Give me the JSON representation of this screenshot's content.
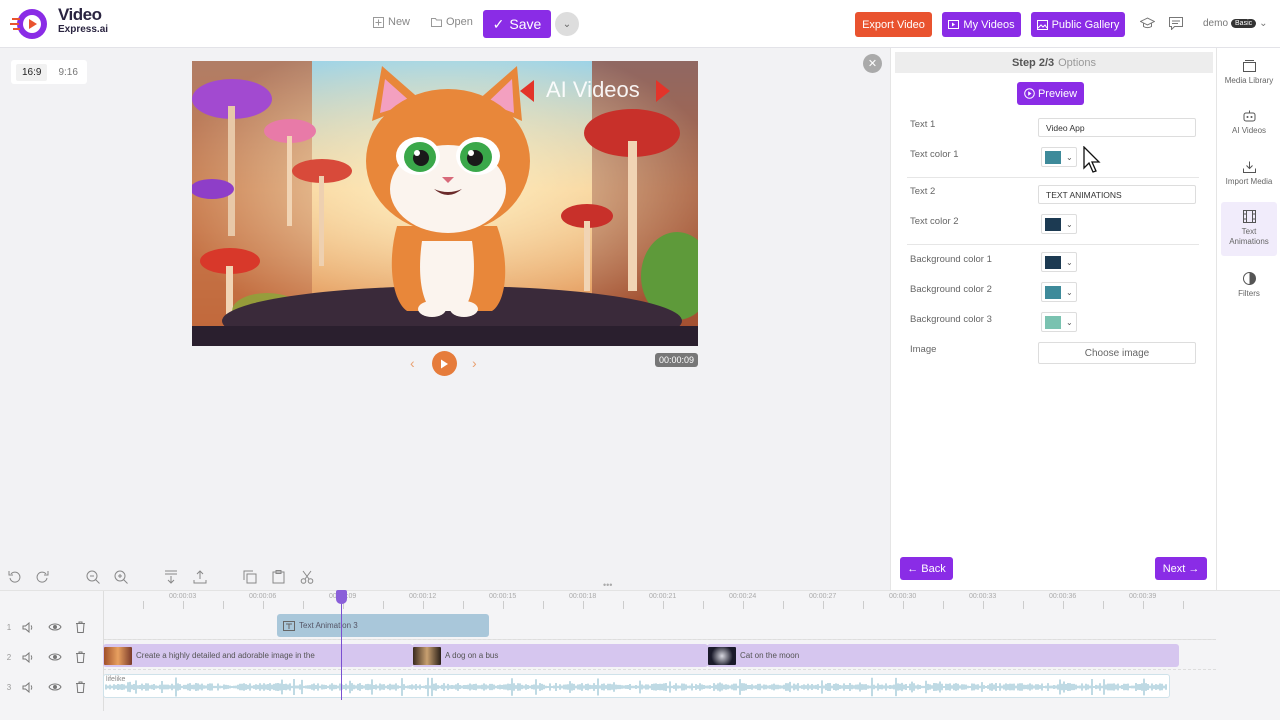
{
  "header": {
    "logo_line1": "Video",
    "logo_line2": "Express.ai",
    "new_label": "New",
    "open_label": "Open",
    "save_label": "Save",
    "export_label": "Export Video",
    "my_videos_label": "My Videos",
    "gallery_label": "Public Gallery",
    "user_name": "demo",
    "user_plan": "Basic"
  },
  "canvas": {
    "ratio_options": [
      "16:9",
      "9:16"
    ],
    "active_ratio": "16:9",
    "overlay_text": "AI Videos",
    "timecode": "00:00:09"
  },
  "panel": {
    "step_label": "Step 2/3",
    "step_sub": "Options",
    "preview_label": "Preview",
    "fields": {
      "text1_label": "Text 1",
      "text1_value": "Video App",
      "text_color1_label": "Text color 1",
      "text2_label": "Text 2",
      "text2_value": "TEXT ANIMATIONS",
      "text_color2_label": "Text color 2",
      "bg1_label": "Background color 1",
      "bg2_label": "Background color 2",
      "bg3_label": "Background color 3",
      "image_label": "Image",
      "choose_image": "Choose image"
    },
    "colors": {
      "text1": "#3e8a9a",
      "text2": "#1c3a52",
      "bg1": "#1c3a52",
      "bg2": "#3e8a9a",
      "bg3": "#7ac2b0"
    },
    "back_label": "Back",
    "next_label": "Next"
  },
  "sidebar": {
    "items": [
      "Media Library",
      "AI Videos",
      "Import Media",
      "Text Animations",
      "Filters"
    ]
  },
  "timeline": {
    "ticks": [
      "00:00:03",
      "00:00:06",
      "00:00:09",
      "00:00:12",
      "00:00:15",
      "00:00:18",
      "00:00:21",
      "00:00:24",
      "00:00:27",
      "00:00:30",
      "00:00:33",
      "00:00:36",
      "00:00:39"
    ],
    "tracks": [
      "1",
      "2",
      "3"
    ],
    "clip_text_anim": "Text Animation 3",
    "clip_a": "Create a highly detailed and adorable image in the",
    "clip_b": "A dog on a bus",
    "clip_c": "Cat on the moon",
    "audio_label": "lifelike"
  },
  "brand_color": "#8a2ce6"
}
